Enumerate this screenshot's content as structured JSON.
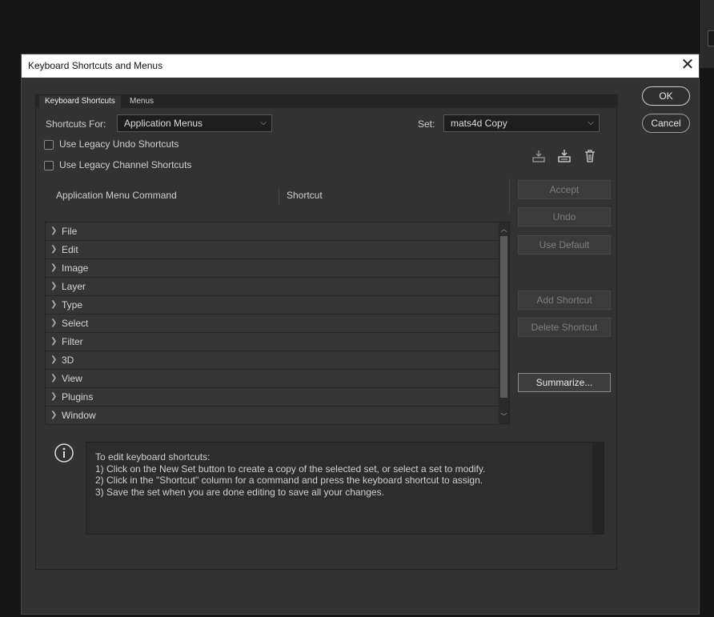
{
  "dialog": {
    "title": "Keyboard Shortcuts and Menus",
    "ok_label": "OK",
    "cancel_label": "Cancel"
  },
  "tabs": [
    {
      "label": "Keyboard Shortcuts",
      "active": true
    },
    {
      "label": "Menus",
      "active": false
    }
  ],
  "shortcuts_for": {
    "label": "Shortcuts For:",
    "value": "Application Menus"
  },
  "set": {
    "label": "Set:",
    "value": "mats4d Copy"
  },
  "checkboxes": [
    {
      "label": "Use Legacy Undo Shortcuts",
      "checked": false
    },
    {
      "label": "Use Legacy Channel Shortcuts",
      "checked": false
    }
  ],
  "table": {
    "col_command": "Application Menu Command",
    "col_shortcut": "Shortcut",
    "rows": [
      "File",
      "Edit",
      "Image",
      "Layer",
      "Type",
      "Select",
      "Filter",
      "3D",
      "View",
      "Plugins",
      "Window"
    ]
  },
  "side_buttons": {
    "accept": "Accept",
    "undo": "Undo",
    "use_default": "Use Default",
    "add_shortcut": "Add Shortcut",
    "delete_shortcut": "Delete Shortcut",
    "summarize": "Summarize..."
  },
  "icons": [
    "save-set-icon",
    "new-set-icon",
    "delete-set-icon",
    "info-icon"
  ],
  "info": {
    "line0": "To edit keyboard shortcuts:",
    "line1": "1) Click on the New Set button to create a copy of the selected set, or select a set to modify.",
    "line2": "2) Click in the \"Shortcut\" column for a command and press the keyboard shortcut to assign.",
    "line3": "3) Save the set when you are done editing to save all your changes."
  },
  "colors": {
    "dialog_bg": "#323232",
    "title_bg": "#ffffff",
    "desktop_bg": "#151515"
  }
}
